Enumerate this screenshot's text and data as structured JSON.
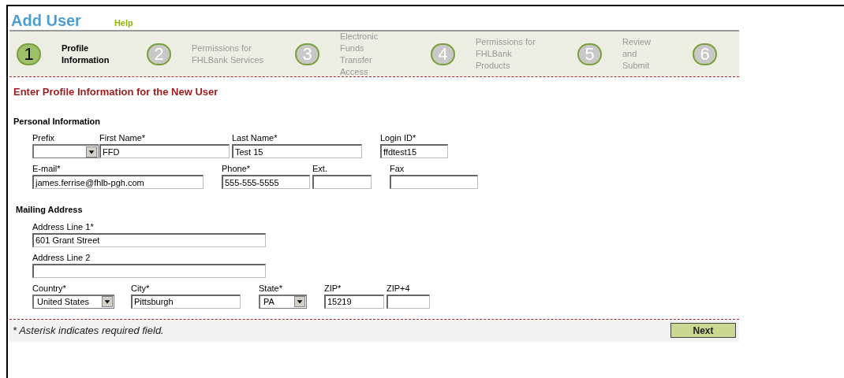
{
  "title": "Add User",
  "help_link": "Help",
  "steps": [
    {
      "number": "1",
      "label": "Profile Information",
      "selected": true
    },
    {
      "number": "2",
      "label": "Permissions for FHLBank Services",
      "selected": false
    },
    {
      "number": "3",
      "label": "Electronic Funds Transfer Access",
      "selected": false
    },
    {
      "number": "4",
      "label": "Permissions for FHLBank Products",
      "selected": false
    },
    {
      "number": "5",
      "label": "Review and Submit",
      "selected": false
    },
    {
      "number": "6",
      "selected": false
    }
  ],
  "heading": "Enter Profile Information for the New User",
  "sections": [
    {
      "title": "Personal Information",
      "fields": [
        {
          "kind": "select",
          "label": "Prefix"
        },
        {
          "kind": "text",
          "label": "First Name*",
          "value": "FFD"
        },
        {
          "kind": "text",
          "label": "Last Name*",
          "value": "Test 15"
        },
        {
          "kind": "text",
          "label": "Login ID*",
          "value": "ffdtest15"
        },
        {
          "kind": "text",
          "label": "E-mail*",
          "value": "james.ferrise@fhlb-pgh.com"
        },
        {
          "kind": "text",
          "label": "Phone*",
          "value": "555-555-5555"
        },
        {
          "kind": "text",
          "label": "Ext."
        },
        {
          "kind": "text",
          "label": "Fax"
        }
      ]
    },
    {
      "title": "Mailing Address",
      "fields": [
        {
          "kind": "text",
          "label": "Address Line 1*",
          "value": "601 Grant Street"
        },
        {
          "kind": "text",
          "label": "Address Line 2"
        },
        {
          "kind": "select",
          "label": "Country*",
          "value": "United States"
        },
        {
          "kind": "text",
          "label": "City*",
          "value": "Pittsburgh"
        },
        {
          "kind": "select",
          "label": "State*",
          "value": "PA"
        },
        {
          "kind": "text",
          "label": "ZIP*",
          "value": "15219"
        },
        {
          "kind": "text",
          "label": "ZIP+4"
        }
      ]
    }
  ],
  "footer_note": "* Asterisk indicates required field.",
  "next_button": "Next"
}
